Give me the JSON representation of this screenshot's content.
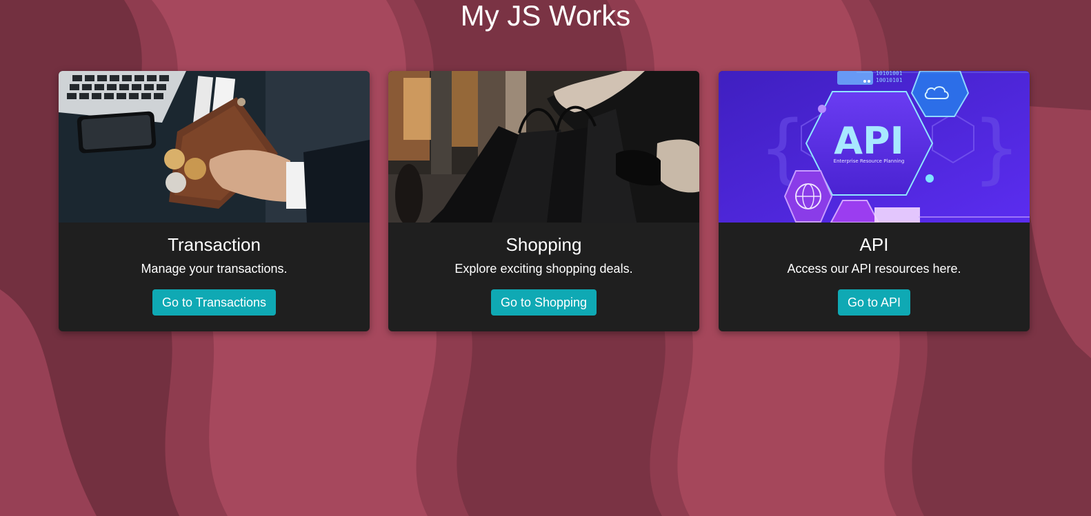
{
  "page": {
    "title": "My JS Works"
  },
  "colors": {
    "background_light": "#a3485c",
    "background_dark": "#6e2d3b",
    "card_background": "#1f1f1f",
    "button_background": "#0fa9b4",
    "text": "#ffffff"
  },
  "cards": [
    {
      "image": "wallet-image",
      "title": "Transaction",
      "description": "Manage your transactions.",
      "button_label": "Go to Transactions"
    },
    {
      "image": "shopping-bags-image",
      "title": "Shopping",
      "description": "Explore exciting shopping deals.",
      "button_label": "Go to Shopping"
    },
    {
      "image": "api-image",
      "title": "API",
      "description": "Access our API resources here.",
      "button_label": "Go to API",
      "image_text": {
        "main": "API",
        "sub": "Enterprise Resource Planning",
        "binary_1": "10101001",
        "binary_2": "10010101"
      }
    }
  ]
}
